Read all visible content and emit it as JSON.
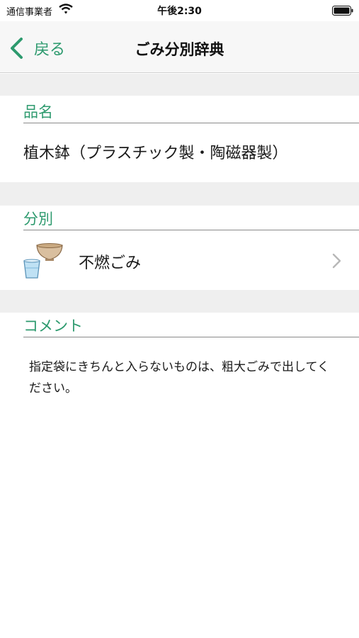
{
  "status_bar": {
    "carrier": "通信事業者",
    "time": "午後2:30",
    "wifi_icon": "wifi-icon",
    "battery_icon": "battery-icon"
  },
  "nav": {
    "back_label": "戻る",
    "back_icon": "chevron-left-icon",
    "title": "ごみ分別辞典"
  },
  "sections": {
    "item_name": {
      "header": "品名",
      "value": "植木鉢（プラスチック製・陶磁器製）"
    },
    "category": {
      "header": "分別",
      "value": "不燃ごみ",
      "icon": "bowl-and-cup-icon",
      "disclosure_icon": "chevron-right-icon"
    },
    "comment": {
      "header": "コメント",
      "value": "指定袋にきちんと入らないものは、粗大ごみで出してください。"
    }
  },
  "colors": {
    "accent": "#2d9a6e",
    "section_gap": "#efefef",
    "nav_background": "#f7f7f7"
  }
}
